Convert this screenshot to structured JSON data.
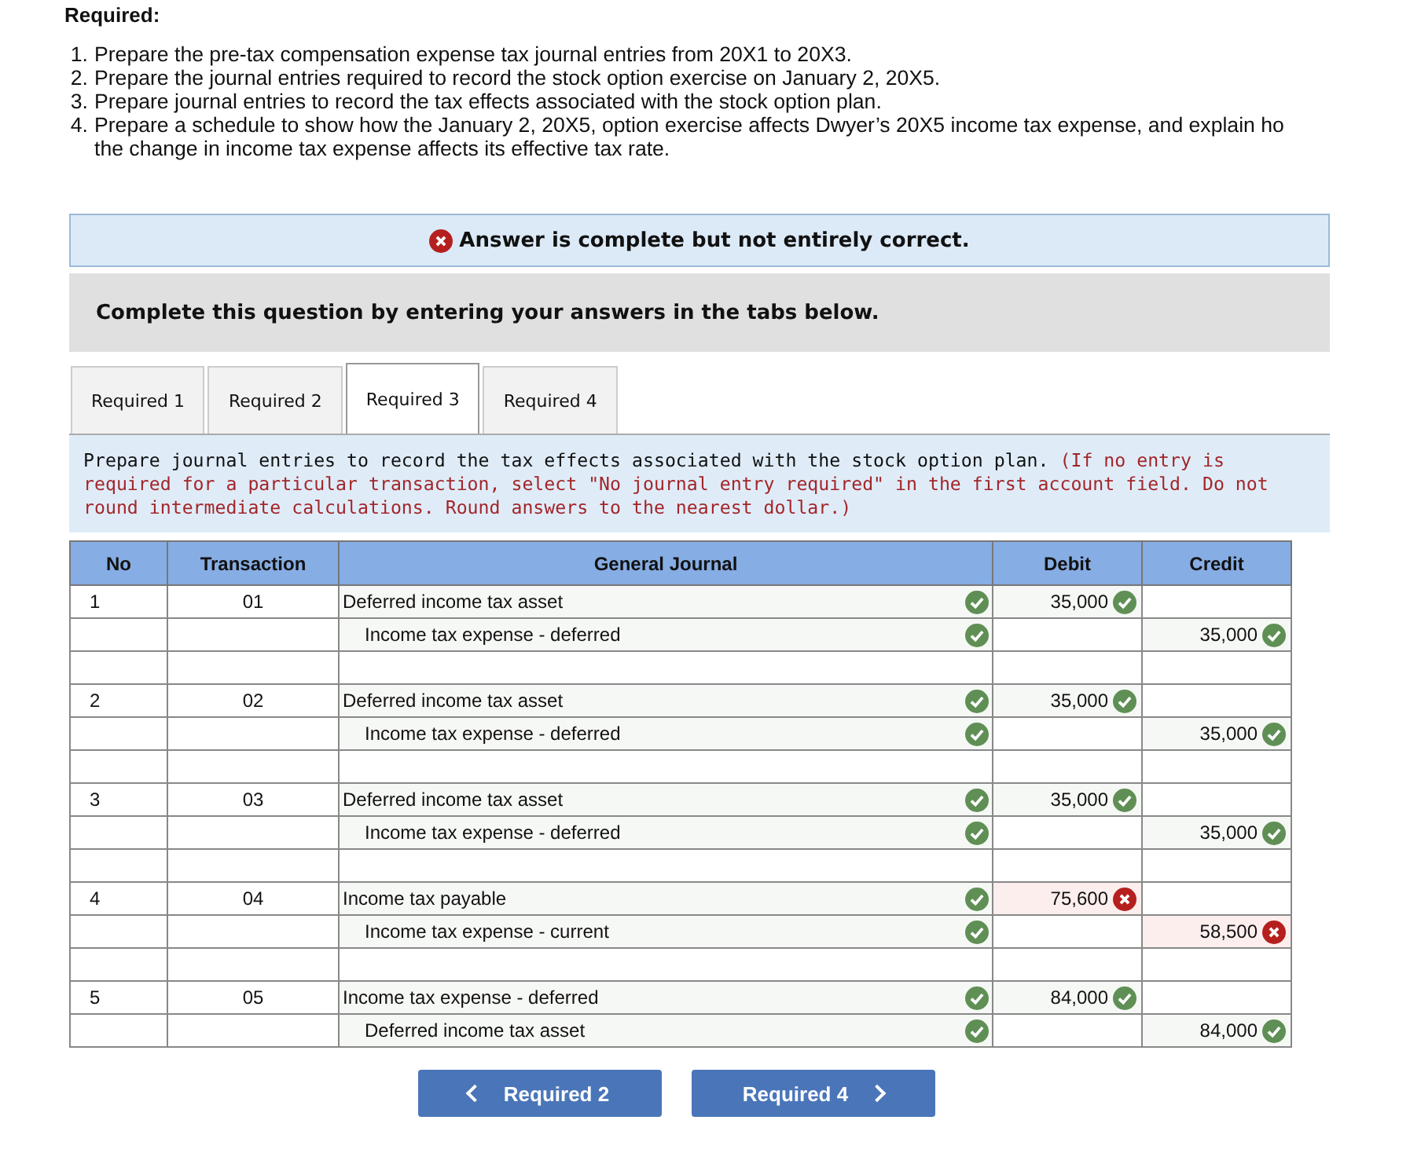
{
  "heading": "Required:",
  "requirements": [
    {
      "marker": "1.",
      "text": "Prepare the pre-tax compensation expense tax journal entries from 20X1 to 20X3."
    },
    {
      "marker": "2.",
      "text": "Prepare the journal entries required to record the stock option exercise on January 2, 20X5."
    },
    {
      "marker": "3.",
      "text": "Prepare journal entries to record the tax effects associated with the stock option plan."
    },
    {
      "marker": "4.",
      "text": "Prepare a schedule to show how the January 2, 20X5, option exercise affects Dwyer’s 20X5 income tax expense, and explain ho the change in income tax expense affects its effective tax rate."
    }
  ],
  "result_banner": {
    "text": "Answer is complete but not entirely correct.",
    "correct": false
  },
  "instruction_bar": "Complete this question by entering your answers in the tabs below.",
  "tabs": [
    {
      "label": "Required 1",
      "selected": false
    },
    {
      "label": "Required 2",
      "selected": false
    },
    {
      "label": "Required 3",
      "selected": true
    },
    {
      "label": "Required 4",
      "selected": false
    }
  ],
  "prompt": {
    "text": "Prepare journal entries to record the tax effects associated with the stock option plan.",
    "note": "(If no entry is required for a particular transaction, select \"No journal entry required\" in the first account field. Do not round intermediate calculations. Round answers to the nearest dollar.)"
  },
  "table": {
    "columns": [
      "No",
      "Transaction",
      "General Journal",
      "Debit",
      "Credit"
    ],
    "entries": [
      {
        "no": "1",
        "transaction": "01",
        "lines": [
          {
            "account": "Deferred income tax asset",
            "kind": "debit",
            "amount": "35,000",
            "account_correct": true,
            "amount_correct": true
          },
          {
            "account": "Income tax expense - deferred",
            "kind": "credit",
            "amount": "35,000",
            "account_correct": true,
            "amount_correct": true
          }
        ]
      },
      {
        "no": "2",
        "transaction": "02",
        "lines": [
          {
            "account": "Deferred income tax asset",
            "kind": "debit",
            "amount": "35,000",
            "account_correct": true,
            "amount_correct": true
          },
          {
            "account": "Income tax expense - deferred",
            "kind": "credit",
            "amount": "35,000",
            "account_correct": true,
            "amount_correct": true
          }
        ]
      },
      {
        "no": "3",
        "transaction": "03",
        "lines": [
          {
            "account": "Deferred income tax asset",
            "kind": "debit",
            "amount": "35,000",
            "account_correct": true,
            "amount_correct": true
          },
          {
            "account": "Income tax expense - deferred",
            "kind": "credit",
            "amount": "35,000",
            "account_correct": true,
            "amount_correct": true
          }
        ]
      },
      {
        "no": "4",
        "transaction": "04",
        "lines": [
          {
            "account": "Income tax payable",
            "kind": "debit",
            "amount": "75,600",
            "account_correct": true,
            "amount_correct": false
          },
          {
            "account": "Income tax expense - current",
            "kind": "credit",
            "amount": "58,500",
            "account_correct": true,
            "amount_correct": false
          }
        ]
      },
      {
        "no": "5",
        "transaction": "05",
        "lines": [
          {
            "account": "Income tax expense - deferred",
            "kind": "debit",
            "amount": "84,000",
            "account_correct": true,
            "amount_correct": true
          },
          {
            "account": "Deferred income tax asset",
            "kind": "credit",
            "amount": "84,000",
            "account_correct": true,
            "amount_correct": true
          }
        ]
      }
    ]
  },
  "nav_buttons": [
    {
      "label": "Required 2",
      "kind": "prev"
    },
    {
      "label": "Required 4",
      "kind": "next"
    }
  ]
}
